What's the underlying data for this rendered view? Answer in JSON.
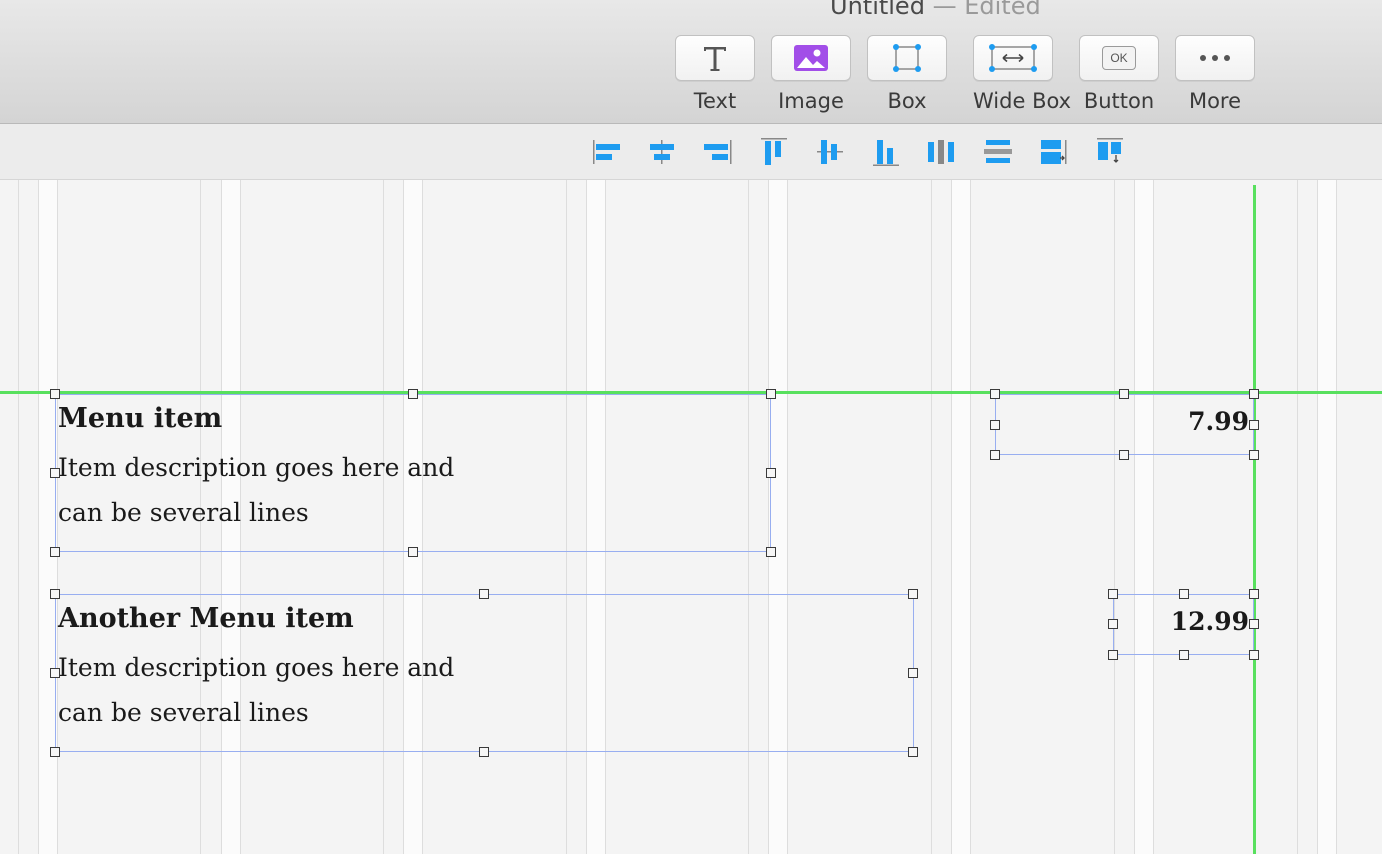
{
  "window": {
    "title": "Untitled",
    "separator": "—",
    "status": "Edited"
  },
  "toolbar": {
    "items": [
      {
        "label": "Text",
        "icon": "text-icon"
      },
      {
        "label": "Image",
        "icon": "image-icon"
      },
      {
        "label": "Box",
        "icon": "box-icon"
      },
      {
        "label": "Wide Box",
        "icon": "wide-box-icon"
      },
      {
        "label": "Button",
        "icon": "button-icon",
        "icon_text": "OK"
      },
      {
        "label": "More",
        "icon": "more-icon"
      }
    ]
  },
  "align_bar": {
    "icons": [
      "align-left-icon",
      "align-center-horizontal-icon",
      "align-right-icon",
      "align-top-icon",
      "align-center-vertical-icon",
      "align-bottom-icon",
      "distribute-horizontal-icon",
      "distribute-vertical-icon",
      "match-width-icon",
      "match-height-icon"
    ]
  },
  "menu_items": [
    {
      "title": "Menu item",
      "description": "Item description goes here and can be several lines",
      "price": "7.99"
    },
    {
      "title": "Another Menu item",
      "description": "Item description goes here and can be several lines",
      "price": "12.99"
    }
  ],
  "colors": {
    "guide": "#58e05e",
    "selection": "#98aef0",
    "accent": "#1e9cf0"
  }
}
